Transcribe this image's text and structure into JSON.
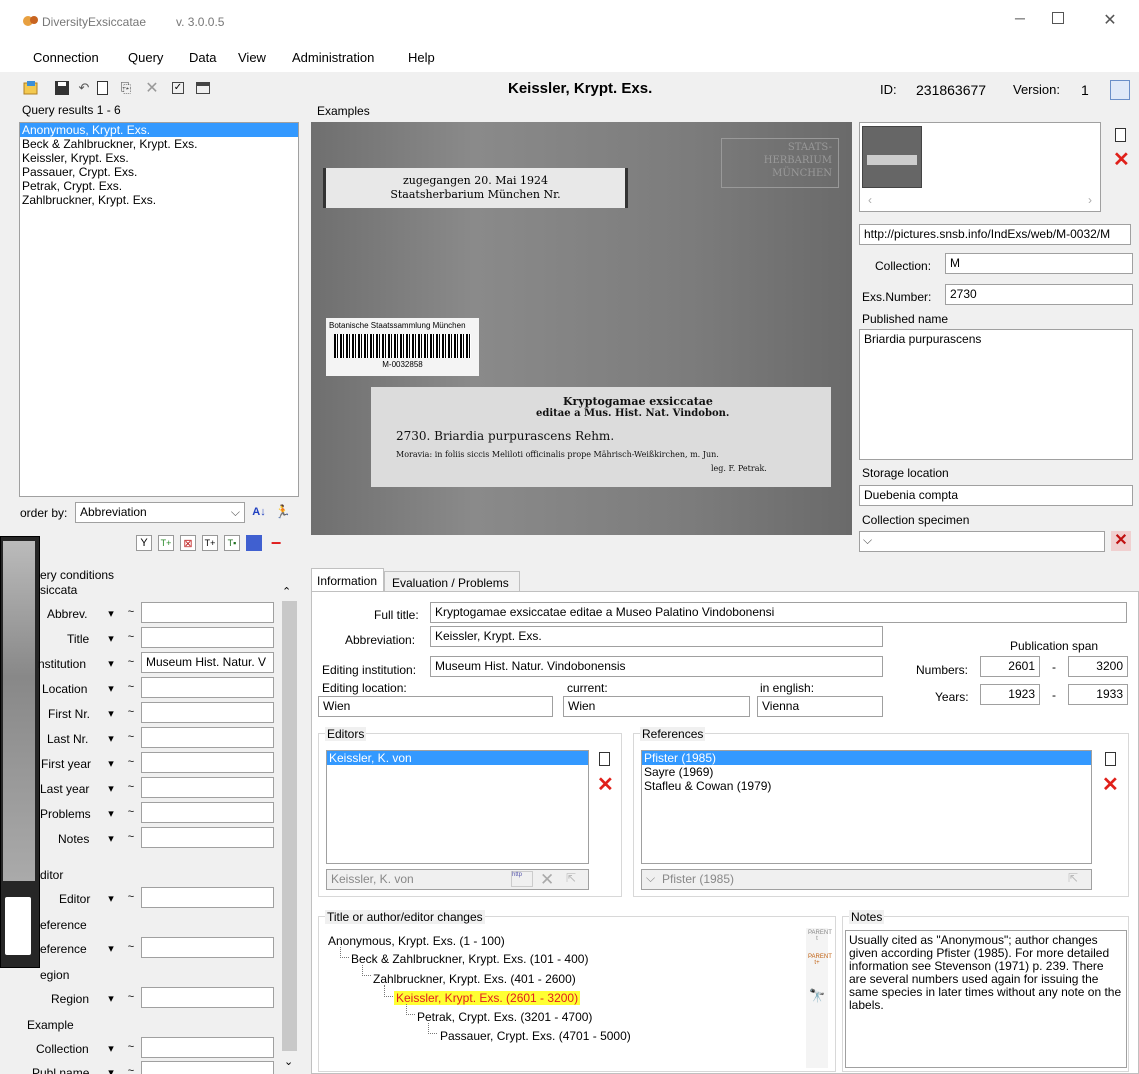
{
  "window": {
    "title": "DiversityExsiccatae",
    "version": "v. 3.0.0.5"
  },
  "menu": [
    "Connection",
    "Query",
    "Data",
    "View",
    "Administration",
    "Help"
  ],
  "header": {
    "record_title": "Keissler, Krypt. Exs.",
    "id_label": "ID:",
    "id_value": "231863677",
    "version_label": "Version:",
    "version_value": "1"
  },
  "query_results": {
    "label": "Query results   1 - 6",
    "items": [
      "Anonymous, Krypt. Exs.",
      "Beck & Zahlbruckner, Krypt. Exs.",
      "Keissler, Krypt. Exs.",
      "Passauer, Crypt. Exs.",
      "Petrak, Crypt. Exs.",
      "Zahlbruckner, Krypt. Exs."
    ],
    "selected_index": 0,
    "order_by_label": "order by:",
    "order_by_value": "Abbreviation"
  },
  "query_conditions": {
    "title": "ery conditions",
    "exsiccata_group": "siccata",
    "fields": [
      {
        "label": "Abbrev.",
        "value": ""
      },
      {
        "label": "Title",
        "value": ""
      },
      {
        "label": "nstitution",
        "value": "Museum Hist. Natur. V"
      },
      {
        "label": "Location",
        "value": ""
      },
      {
        "label": "First Nr.",
        "value": ""
      },
      {
        "label": "Last Nr.",
        "value": ""
      },
      {
        "label": "First year",
        "value": ""
      },
      {
        "label": "Last year",
        "value": ""
      },
      {
        "label": "Problems",
        "value": ""
      },
      {
        "label": "Notes",
        "value": ""
      }
    ],
    "editor_group": "ditor",
    "editor_label": "Editor",
    "reference_group": "eference",
    "reference_label": "eference",
    "region_group": "egion",
    "region_label": "Region",
    "example_group": "Example",
    "collection_label": "Collection",
    "publ_label": "Publ name"
  },
  "examples": {
    "title": "Examples",
    "image_text": {
      "stamp": "STAATS-\nHERBARIUM\nMÜNCHEN",
      "received_line1": "zugegangen 20. Mai 1924",
      "received_line2": "Staatsherbarium München Nr.",
      "barcode_title": "Botanische Staatssammlung München",
      "barcode_number": "M-0032858",
      "label_line1": "Kryptogamae exsiccatae",
      "label_line2": "editae a Mus. Hist. Nat. Vindobon.",
      "label_line3": "2730. Briardia purpurascens Rehm.",
      "label_line4": "Moravia: in foliis siccis Meliloti officinalis prope Mährisch-Weißkirchen, m. Jun.",
      "label_line5": "leg. F. Petrak."
    },
    "url": "http://pictures.snsb.info/IndExs/web/M-0032/M",
    "collection_label": "Collection:",
    "collection_value": "M",
    "exs_number_label": "Exs.Number:",
    "exs_number_value": "2730",
    "published_name_label": "Published name",
    "published_name_value": "Briardia purpurascens",
    "storage_location_label": "Storage location",
    "storage_location_value": "Duebenia compta",
    "collection_specimen_label": "Collection specimen"
  },
  "tabs": [
    "Information",
    "Evaluation / Problems"
  ],
  "info": {
    "full_title_label": "Full title:",
    "full_title_value": "Kryptogamae exsiccatae editae a Museo Palatino Vindobonensi",
    "abbreviation_label": "Abbreviation:",
    "abbreviation_value": "Keissler, Krypt. Exs.",
    "editing_institution_label": "Editing institution:",
    "editing_institution_value": "Museum Hist. Natur. Vindobonensis",
    "editing_location_label": "Editing location:",
    "editing_location_value": "Wien",
    "current_label": "current:",
    "current_value": "Wien",
    "english_label": "in english:",
    "english_value": "Vienna",
    "publication_span_label": "Publication span",
    "numbers_label": "Numbers:",
    "numbers_from": "2601",
    "numbers_to": "3200",
    "years_label": "Years:",
    "years_from": "1923",
    "years_to": "1933",
    "dash": "-"
  },
  "editors": {
    "title": "Editors",
    "items": [
      "Keissler, K. von"
    ],
    "input": "Keissler, K. von"
  },
  "references": {
    "title": "References",
    "items": [
      "Pfister (1985)",
      "Sayre (1969)",
      "Stafleu & Cowan (1979)"
    ],
    "input": "Pfister (1985)"
  },
  "changes": {
    "title": "Title or author/editor changes",
    "items": [
      "Anonymous, Krypt. Exs. (1 - 100)",
      "Beck & Zahlbruckner, Krypt. Exs. (101 - 400)",
      "Zahlbruckner, Krypt. Exs. (401 - 2600)",
      "Keissler, Krypt. Exs. (2601 - 3200)",
      "Petrak, Crypt. Exs. (3201 - 4700)",
      "Passauer, Crypt. Exs. (4701 - 5000)"
    ],
    "highlighted_index": 3
  },
  "notes": {
    "title": "Notes",
    "text": "Usually cited as \"Anonymous\"; author changes given according Pfister (1985). For more detailed information see Stevenson (1971) p. 239. There are several numbers used again for issuing the same species in later times without any note on the labels."
  },
  "colors": {
    "selection": "#3399ff",
    "highlight": "#ffff33",
    "delete": "#e0201a"
  }
}
